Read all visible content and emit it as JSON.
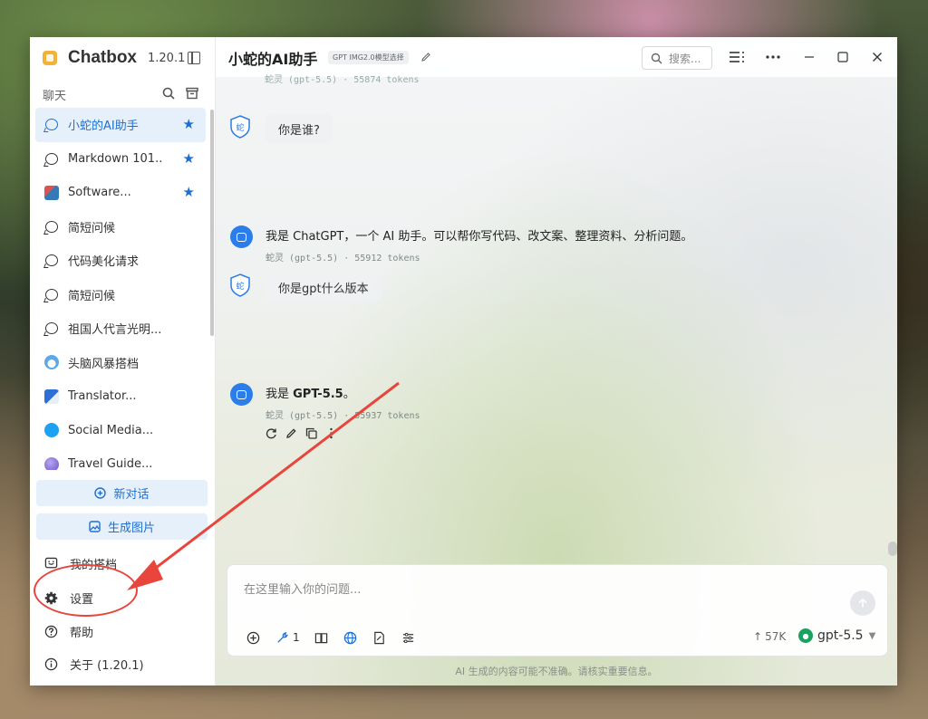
{
  "app": {
    "name": "Chatbox",
    "version": "1.20.1"
  },
  "sidebar": {
    "section_label": "聊天",
    "sessions": [
      {
        "label": "小蛇的AI助手",
        "icon": "chat-bubble-icon",
        "starred": true,
        "active": true
      },
      {
        "label": "Markdown 101...",
        "icon": "chat-bubble-icon",
        "starred": true
      },
      {
        "label": "Software...",
        "icon": "software-avatar-icon",
        "starred": true
      },
      {
        "label": "简短问候",
        "icon": "chat-bubble-icon"
      },
      {
        "label": "代码美化请求",
        "icon": "chat-bubble-icon"
      },
      {
        "label": "简短问候",
        "icon": "chat-bubble-icon"
      },
      {
        "label": "祖国人代言光明...",
        "icon": "chat-bubble-icon"
      },
      {
        "label": "头脑风暴搭档",
        "icon": "cloud-avatar-icon"
      },
      {
        "label": "Translator...",
        "icon": "translator-avatar-icon"
      },
      {
        "label": "Social Media...",
        "icon": "twitter-avatar-icon"
      },
      {
        "label": "Travel Guide...",
        "icon": "globe-avatar-icon"
      }
    ],
    "new_chat": "新对话",
    "new_image": "生成图片",
    "my_partners": "我的搭档",
    "settings": "设置",
    "help": "帮助",
    "about": "关于 (1.20.1)"
  },
  "header": {
    "title": "小蛇的AI助手",
    "model_tag": "GPT IMG2.0模型选择",
    "search_placeholder": "搜索..."
  },
  "messages": {
    "cut_meta": "蛇灵 (gpt-5.5) · 55874 tokens",
    "m1_user": "你是谁?",
    "m2_bot": "我是 ChatGPT，一个 AI 助手。可以帮你写代码、改文案、整理资料、分析问题。",
    "m2_meta": "蛇灵 (gpt-5.5) · 55912 tokens",
    "m3_user": "你是gpt什么版本",
    "m4_bot_prefix": "我是 ",
    "m4_bot_bold": "GPT-5.5",
    "m4_bot_suffix": "。",
    "m4_meta": "蛇灵 (gpt-5.5) · 55937 tokens"
  },
  "input": {
    "placeholder": "在这里输入你的问题...",
    "tool_count": "1",
    "tokens": "57K",
    "model": "gpt-5.5"
  },
  "footer_note": "AI 生成的内容可能不准确。请核实重要信息。",
  "colors": {
    "accent": "#1f6fd1",
    "annotation": "#e8453c",
    "model_badge": "#1aa35f"
  }
}
